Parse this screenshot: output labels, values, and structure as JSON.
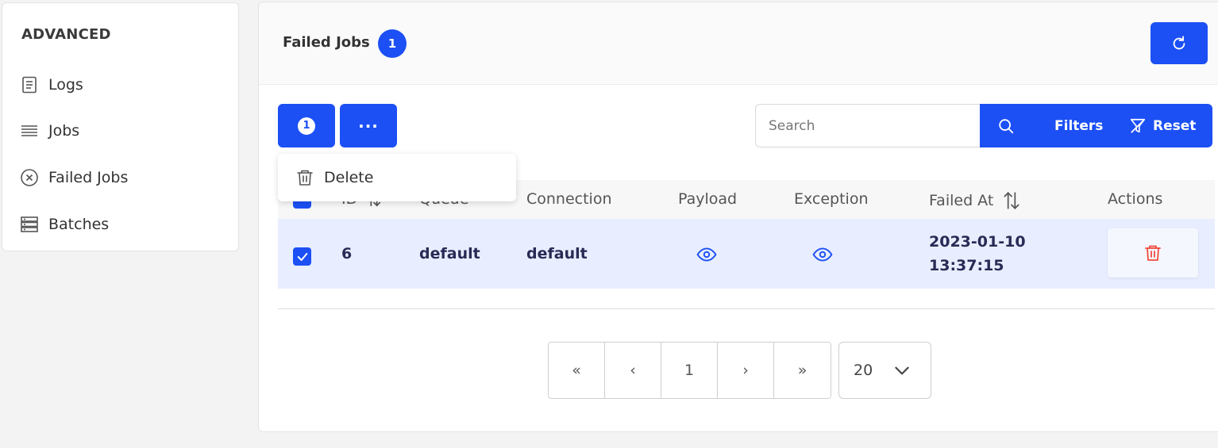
{
  "sidebar": {
    "title": "ADVANCED",
    "items": [
      {
        "label": "Logs",
        "icon": "document-icon"
      },
      {
        "label": "Jobs",
        "icon": "list-icon"
      },
      {
        "label": "Failed Jobs",
        "icon": "circle-x-icon"
      },
      {
        "label": "Batches",
        "icon": "server-icon"
      }
    ]
  },
  "header": {
    "title": "Failed Jobs",
    "count": "1",
    "refresh_icon": "refresh-icon"
  },
  "toolbar": {
    "selected_count": "1",
    "more_label": "···",
    "search_placeholder": "Search",
    "search_value": "",
    "filters_label": "Filters",
    "reset_label": "Reset"
  },
  "dropdown": {
    "delete_label": "Delete"
  },
  "table": {
    "columns": [
      "ID",
      "Queue",
      "Connection",
      "Payload",
      "Exception",
      "Failed At",
      "Actions"
    ],
    "rows": [
      {
        "id": "6",
        "queue": "default",
        "connection": "default",
        "failed_at_date": "2023-01-10",
        "failed_at_time": "13:37:15",
        "selected": true
      }
    ]
  },
  "pagination": {
    "first": "«",
    "prev": "‹",
    "current_page": "1",
    "next": "›",
    "last": "»",
    "per_page": "20"
  },
  "colors": {
    "accent": "#1c50f5",
    "row_selected": "#e8eeff",
    "danger": "#f04a3c"
  }
}
